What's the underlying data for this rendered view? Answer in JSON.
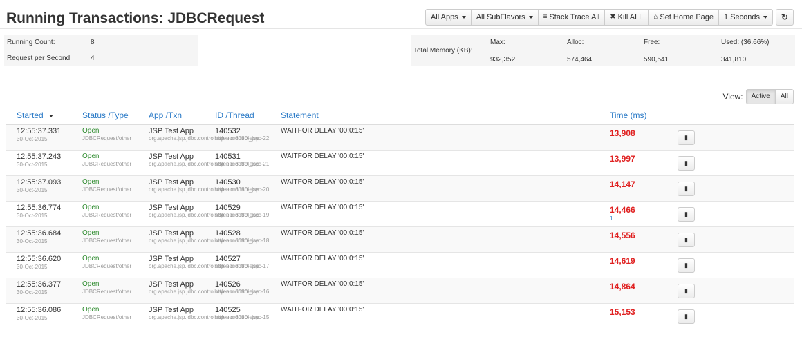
{
  "title": "Running Transactions: JDBCRequest",
  "toolbar": {
    "all_apps": "All Apps",
    "all_subflavors": "All SubFlavors",
    "stack_trace_all": "Stack Trace All",
    "kill_all": "Kill ALL",
    "set_home_page": "Set Home Page",
    "interval": "1 Seconds"
  },
  "stats": {
    "running_count_label": "Running Count:",
    "running_count": "8",
    "rps_label": "Request per Second:",
    "rps": "4"
  },
  "memory": {
    "label": "Total Memory (KB):",
    "max_label": "Max:",
    "max": "932,352",
    "alloc_label": "Alloc:",
    "alloc": "574,464",
    "free_label": "Free:",
    "free": "590,541",
    "used_label": "Used: (36.66%)",
    "used": "341,810"
  },
  "view": {
    "label": "View:",
    "active": "Active",
    "all": "All"
  },
  "columns": {
    "started": "Started",
    "status": "Status /Type",
    "app": "App /Txn",
    "id": "ID /Thread",
    "statement": "Statement",
    "time": "Time (ms)"
  },
  "rows": [
    {
      "time": "12:55:37.331",
      "date": "30-Oct-2015",
      "status": "Open",
      "type": "JDBCRequest/other",
      "app": "JSP Test App",
      "txn": "org.apache.jsp.jdbc.controls.sleepcontrol_jsp",
      "id": "140532",
      "thread": "http-nio-8080-exec-22",
      "statement": "WAITFOR DELAY '00:0:15'",
      "ms": "13,908",
      "sub": ""
    },
    {
      "time": "12:55:37.243",
      "date": "30-Oct-2015",
      "status": "Open",
      "type": "JDBCRequest/other",
      "app": "JSP Test App",
      "txn": "org.apache.jsp.jdbc.controls.sleepcontrol_jsp",
      "id": "140531",
      "thread": "http-nio-8080-exec-21",
      "statement": "WAITFOR DELAY '00:0:15'",
      "ms": "13,997",
      "sub": ""
    },
    {
      "time": "12:55:37.093",
      "date": "30-Oct-2015",
      "status": "Open",
      "type": "JDBCRequest/other",
      "app": "JSP Test App",
      "txn": "org.apache.jsp.jdbc.controls.sleepcontrol_jsp",
      "id": "140530",
      "thread": "http-nio-8080-exec-20",
      "statement": "WAITFOR DELAY '00:0:15'",
      "ms": "14,147",
      "sub": ""
    },
    {
      "time": "12:55:36.774",
      "date": "30-Oct-2015",
      "status": "Open",
      "type": "JDBCRequest/other",
      "app": "JSP Test App",
      "txn": "org.apache.jsp.jdbc.controls.sleepcontrol_jsp",
      "id": "140529",
      "thread": "http-nio-8080-exec-19",
      "statement": "WAITFOR DELAY '00:0:15'",
      "ms": "14,466",
      "sub": "1"
    },
    {
      "time": "12:55:36.684",
      "date": "30-Oct-2015",
      "status": "Open",
      "type": "JDBCRequest/other",
      "app": "JSP Test App",
      "txn": "org.apache.jsp.jdbc.controls.sleepcontrol_jsp",
      "id": "140528",
      "thread": "http-nio-8080-exec-18",
      "statement": "WAITFOR DELAY '00:0:15'",
      "ms": "14,556",
      "sub": ""
    },
    {
      "time": "12:55:36.620",
      "date": "30-Oct-2015",
      "status": "Open",
      "type": "JDBCRequest/other",
      "app": "JSP Test App",
      "txn": "org.apache.jsp.jdbc.controls.sleepcontrol_jsp",
      "id": "140527",
      "thread": "http-nio-8080-exec-17",
      "statement": "WAITFOR DELAY '00:0:15'",
      "ms": "14,619",
      "sub": ""
    },
    {
      "time": "12:55:36.377",
      "date": "30-Oct-2015",
      "status": "Open",
      "type": "JDBCRequest/other",
      "app": "JSP Test App",
      "txn": "org.apache.jsp.jdbc.controls.sleepcontrol_jsp",
      "id": "140526",
      "thread": "http-nio-8080-exec-16",
      "statement": "WAITFOR DELAY '00:0:15'",
      "ms": "14,864",
      "sub": ""
    },
    {
      "time": "12:55:36.086",
      "date": "30-Oct-2015",
      "status": "Open",
      "type": "JDBCRequest/other",
      "app": "JSP Test App",
      "txn": "org.apache.jsp.jdbc.controls.sleepcontrol_jsp",
      "id": "140525",
      "thread": "http-nio-8080-exec-15",
      "statement": "WAITFOR DELAY '00:0:15'",
      "ms": "15,153",
      "sub": ""
    }
  ],
  "icons": {
    "stack_trace": "align-left-icon",
    "kill": "times-icon",
    "home": "home-icon",
    "refresh": "refresh-icon",
    "row_action": "book-icon"
  },
  "colors": {
    "link": "#2a7ac7",
    "open_status": "#2e8b2e",
    "time_ms": "#e02222"
  }
}
